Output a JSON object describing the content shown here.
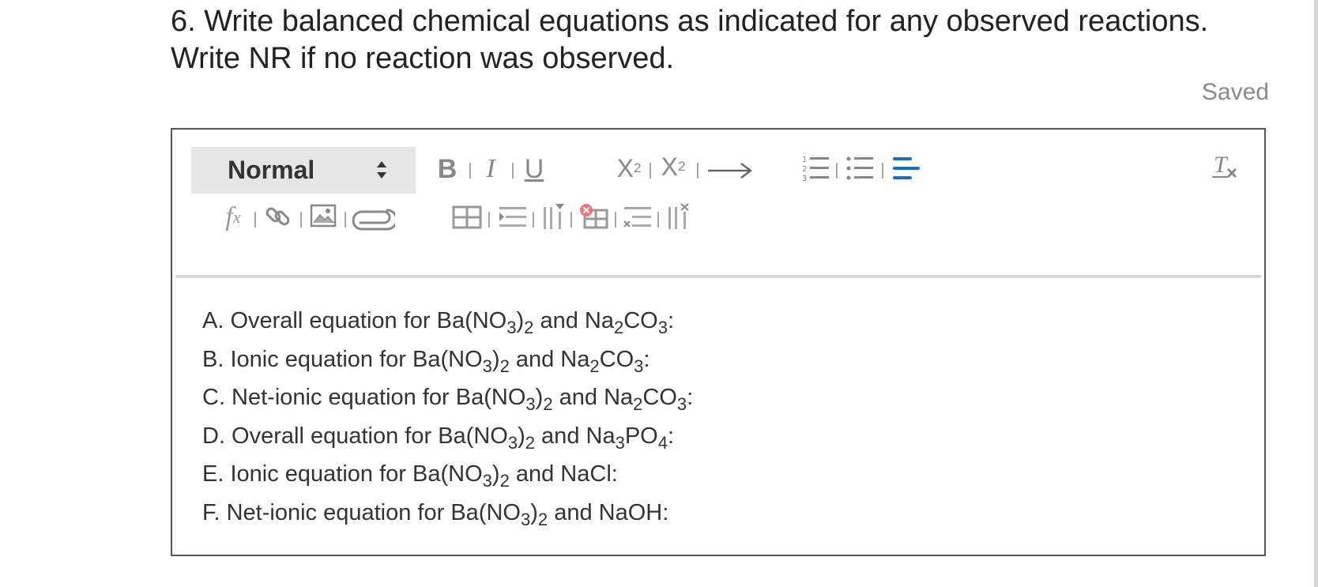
{
  "question": {
    "line1": "6. Write balanced chemical equations as indicated for any observed reactions.",
    "line2": "Write NR if no reaction was observed."
  },
  "status": {
    "saved": "Saved"
  },
  "toolbar": {
    "style_select": "Normal",
    "bold": "B",
    "italic": "I",
    "underline": "U",
    "subscript": {
      "base": "X",
      "script": "2"
    },
    "superscript": {
      "base": "X",
      "script": "2"
    },
    "arrow": "⟶",
    "formula": {
      "f": "f",
      "x": "x"
    },
    "accent_color": "#1a6fc9"
  },
  "editor": {
    "lines": [
      [
        {
          "t": "A. Overall equation for Ba(NO"
        },
        {
          "s": "3"
        },
        {
          "t": ")"
        },
        {
          "s": "2"
        },
        {
          "t": " and Na"
        },
        {
          "s": "2"
        },
        {
          "t": "CO"
        },
        {
          "s": "3"
        },
        {
          "t": ":"
        }
      ],
      [
        {
          "t": "B. Ionic equation for Ba(NO"
        },
        {
          "s": "3"
        },
        {
          "t": ")"
        },
        {
          "s": "2"
        },
        {
          "t": " and Na"
        },
        {
          "s": "2"
        },
        {
          "t": "CO"
        },
        {
          "s": "3"
        },
        {
          "t": ":"
        }
      ],
      [
        {
          "t": "C. Net-ionic equation for Ba(NO"
        },
        {
          "s": "3"
        },
        {
          "t": ")"
        },
        {
          "s": "2"
        },
        {
          "t": " and Na"
        },
        {
          "s": "2"
        },
        {
          "t": "CO"
        },
        {
          "s": "3"
        },
        {
          "t": ":"
        }
      ],
      [
        {
          "t": "D. Overall equation for Ba(NO"
        },
        {
          "s": "3"
        },
        {
          "t": ")"
        },
        {
          "s": "2"
        },
        {
          "t": " and Na"
        },
        {
          "s": "3"
        },
        {
          "t": "PO"
        },
        {
          "s": "4"
        },
        {
          "t": ":"
        }
      ],
      [
        {
          "t": "E. Ionic equation for Ba(NO"
        },
        {
          "s": "3"
        },
        {
          "t": ")"
        },
        {
          "s": "2"
        },
        {
          "t": " and NaCl:"
        }
      ],
      [
        {
          "t": "F. Net-ionic equation for Ba(NO"
        },
        {
          "s": "3"
        },
        {
          "t": ")"
        },
        {
          "s": "2"
        },
        {
          "t": " and NaOH:"
        }
      ]
    ]
  }
}
